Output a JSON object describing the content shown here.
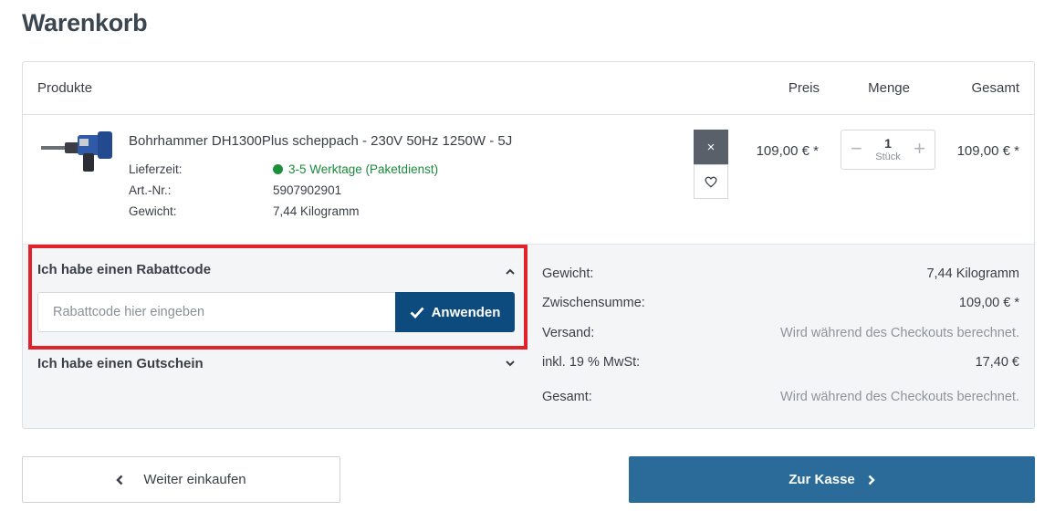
{
  "page": {
    "title": "Warenkorb"
  },
  "cart": {
    "columns": {
      "products": "Produkte",
      "price": "Preis",
      "quantity": "Menge",
      "total": "Gesamt"
    },
    "items": [
      {
        "name": "Bohrhammer DH1300Plus scheppach - 230V 50Hz 1250W - 5J",
        "delivery_label": "Lieferzeit:",
        "delivery_value": "3-5 Werktage (Paketdienst)",
        "sku_label": "Art.-Nr.:",
        "sku_value": "5907902901",
        "weight_label": "Gewicht:",
        "weight_value": "7,44 Kilogramm",
        "unit_price": "109,00 € *",
        "quantity": "1",
        "quantity_unit": "Stück",
        "line_total": "109,00 € *",
        "remove_symbol": "×",
        "icons": {
          "remove": "close-icon",
          "wishlist": "heart-icon",
          "minus": "minus-icon",
          "plus": "plus-icon"
        }
      }
    ]
  },
  "coupon": {
    "title": "Ich habe einen Rabattcode",
    "placeholder": "Rabattcode hier eingeben",
    "apply_label": "Anwenden",
    "icon": "check-icon",
    "highlight_color": "#e0222b"
  },
  "voucher": {
    "title": "Ich habe einen Gutschein"
  },
  "summary": {
    "weight_label": "Gewicht:",
    "weight_value": "7,44  Kilogramm",
    "subtotal_label": "Zwischensumme:",
    "subtotal_value": "109,00 € *",
    "shipping_label": "Versand:",
    "shipping_value": "Wird während des Checkouts berechnet.",
    "vat_label": "inkl. 19 % MwSt:",
    "vat_value": "17,40 €",
    "total_label": "Gesamt:",
    "total_value": "Wird während des Checkouts berechnet."
  },
  "actions": {
    "continue_label": "Weiter einkaufen",
    "checkout_label": "Zur Kasse"
  },
  "colors": {
    "primary": "#0d4a7d",
    "checkout": "#2a6b9a",
    "success": "#1b8f3a",
    "remove": "#5a6069"
  }
}
